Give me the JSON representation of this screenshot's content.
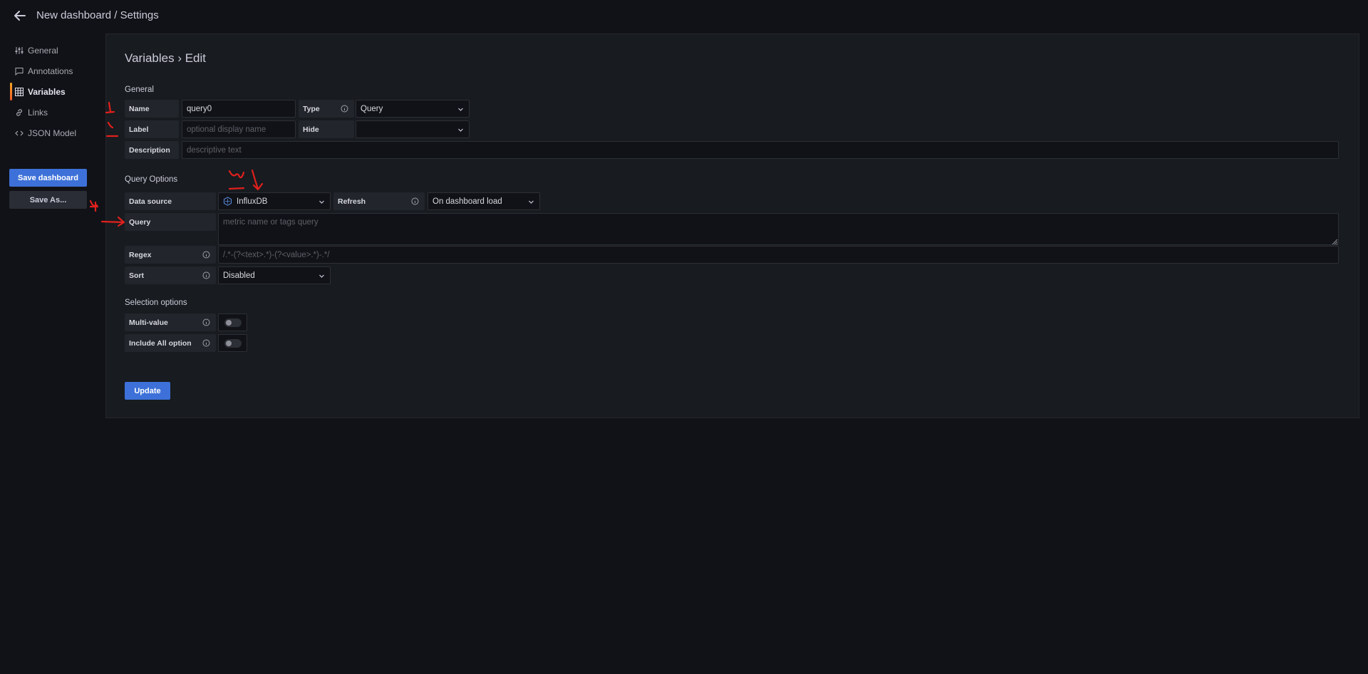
{
  "header": {
    "title": "New dashboard / Settings"
  },
  "sidebar": {
    "items": [
      {
        "label": "General",
        "icon": "sliders-icon",
        "active": false
      },
      {
        "label": "Annotations",
        "icon": "comment-icon",
        "active": false
      },
      {
        "label": "Variables",
        "icon": "table-icon",
        "active": true
      },
      {
        "label": "Links",
        "icon": "link-icon",
        "active": false
      },
      {
        "label": "JSON Model",
        "icon": "code-icon",
        "active": false
      }
    ],
    "save_dashboard": "Save dashboard",
    "save_as": "Save As..."
  },
  "main": {
    "heading": "Variables › Edit",
    "general": {
      "title": "General",
      "name_label": "Name",
      "name_value": "query0",
      "type_label": "Type",
      "type_value": "Query",
      "label_label": "Label",
      "label_placeholder": "optional display name",
      "hide_label": "Hide",
      "hide_value": "",
      "description_label": "Description",
      "description_placeholder": "descriptive text"
    },
    "query_options": {
      "title": "Query Options",
      "datasource_label": "Data source",
      "datasource_value": "InfluxDB",
      "refresh_label": "Refresh",
      "refresh_value": "On dashboard load",
      "query_label": "Query",
      "query_placeholder": "metric name or tags query",
      "regex_label": "Regex",
      "regex_placeholder": "/.*-(?<text>.*)-(?<value>.*)-.*/",
      "sort_label": "Sort",
      "sort_value": "Disabled"
    },
    "selection": {
      "title": "Selection options",
      "multi_label": "Multi-value",
      "multi_on": false,
      "include_all_label": "Include All option",
      "include_all_on": false
    },
    "update_label": "Update"
  },
  "colors": {
    "accent": "#3d71d9",
    "background": "#111217",
    "panel": "#181b1f",
    "active_indicator": "#f5a623",
    "annotation": "#e0201d"
  }
}
